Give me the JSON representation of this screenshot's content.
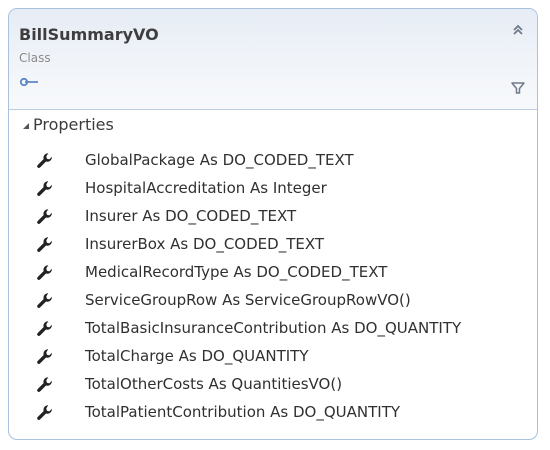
{
  "class_shape": {
    "name": "BillSummaryVO",
    "stereotype": "Class",
    "icons": {
      "collapse": "double-chevron-up-icon",
      "inheritance": "inheritance-link-icon",
      "filter": "filter-icon",
      "member": "wrench-icon",
      "section_toggle": "triangle-expanded-icon"
    },
    "colors": {
      "border": "#a9c1dd",
      "header_top": "#e6ecf5",
      "header_bottom": "#f7f9fc",
      "accent": "#5b86c2"
    },
    "sections": [
      {
        "label": "Properties",
        "members": [
          "GlobalPackage As DO_CODED_TEXT",
          "HospitalAccreditation As Integer",
          "Insurer As DO_CODED_TEXT",
          "InsurerBox As DO_CODED_TEXT",
          "MedicalRecordType As DO_CODED_TEXT",
          "ServiceGroupRow As ServiceGroupRowVO()",
          "TotalBasicInsuranceContribution As DO_QUANTITY",
          "TotalCharge As DO_QUANTITY",
          "TotalOtherCosts As QuantitiesVO()",
          "TotalPatientContribution As DO_QUANTITY"
        ]
      }
    ]
  }
}
